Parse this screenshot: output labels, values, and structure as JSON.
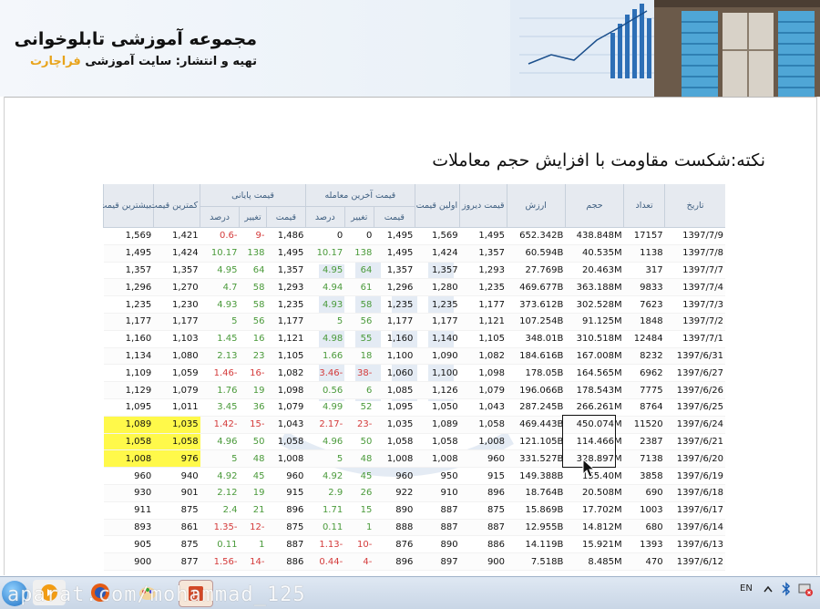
{
  "banner": {
    "title": "مجموعه آموزشی تابلوخوانی",
    "subtitle_prefix": "تهیه و انتشار: سایت آموزشی ",
    "subtitle_brand": "فراچارت"
  },
  "note": "نکته:شکست مقاومت  با افزایش حجم معاملات",
  "table": {
    "headers": {
      "date": "تاریخ",
      "count": "تعداد",
      "volume": "حجم",
      "value": "ارزش",
      "yesterday": "قیمت دیروز",
      "first": "اولین قیمت",
      "last_group": "قیمت آخرین معامله",
      "close_group": "قیمت پایانی",
      "min": "کمترین قیمت",
      "max": "بیشترین قیمت",
      "price": "قیمت",
      "change": "تغییر",
      "percent": "درصد"
    },
    "rows": [
      {
        "date": "1397/7/9",
        "count": "17157",
        "volume": "438.848M",
        "value": "652.342B",
        "yesterday": "1,495",
        "first": "1,569",
        "last": "1,495",
        "last_ch": "0",
        "last_pct": "0",
        "close": "1,486",
        "close_ch": "-9",
        "close_pct": "-0.6",
        "min": "1,421",
        "max": "1,569"
      },
      {
        "date": "1397/7/8",
        "count": "1138",
        "volume": "40.535M",
        "value": "60.594B",
        "yesterday": "1,357",
        "first": "1,424",
        "last": "1,495",
        "last_ch": "138",
        "last_pct": "10.17",
        "close": "1,495",
        "close_ch": "138",
        "close_pct": "10.17",
        "min": "1,424",
        "max": "1,495"
      },
      {
        "date": "1397/7/7",
        "count": "317",
        "volume": "20.463M",
        "value": "27.769B",
        "yesterday": "1,293",
        "first": "1,357",
        "last": "1,357",
        "last_ch": "64",
        "last_pct": "4.95",
        "close": "1,357",
        "close_ch": "64",
        "close_pct": "4.95",
        "min": "1,357",
        "max": "1,357"
      },
      {
        "date": "1397/7/4",
        "count": "9833",
        "volume": "363.188M",
        "value": "469.677B",
        "yesterday": "1,235",
        "first": "1,280",
        "last": "1,296",
        "last_ch": "61",
        "last_pct": "4.94",
        "close": "1,293",
        "close_ch": "58",
        "close_pct": "4.7",
        "min": "1,270",
        "max": "1,296"
      },
      {
        "date": "1397/7/3",
        "count": "7623",
        "volume": "302.528M",
        "value": "373.612B",
        "yesterday": "1,177",
        "first": "1,235",
        "last": "1,235",
        "last_ch": "58",
        "last_pct": "4.93",
        "close": "1,235",
        "close_ch": "58",
        "close_pct": "4.93",
        "min": "1,230",
        "max": "1,235"
      },
      {
        "date": "1397/7/2",
        "count": "1848",
        "volume": "91.125M",
        "value": "107.254B",
        "yesterday": "1,121",
        "first": "1,177",
        "last": "1,177",
        "last_ch": "56",
        "last_pct": "5",
        "close": "1,177",
        "close_ch": "56",
        "close_pct": "5",
        "min": "1,177",
        "max": "1,177"
      },
      {
        "date": "1397/7/1",
        "count": "12484",
        "volume": "310.518M",
        "value": "348.01B",
        "yesterday": "1,105",
        "first": "1,140",
        "last": "1,160",
        "last_ch": "55",
        "last_pct": "4.98",
        "close": "1,121",
        "close_ch": "16",
        "close_pct": "1.45",
        "min": "1,103",
        "max": "1,160"
      },
      {
        "date": "1397/6/31",
        "count": "8232",
        "volume": "167.008M",
        "value": "184.616B",
        "yesterday": "1,082",
        "first": "1,090",
        "last": "1,100",
        "last_ch": "18",
        "last_pct": "1.66",
        "close": "1,105",
        "close_ch": "23",
        "close_pct": "2.13",
        "min": "1,080",
        "max": "1,134"
      },
      {
        "date": "1397/6/27",
        "count": "6962",
        "volume": "164.565M",
        "value": "178.05B",
        "yesterday": "1,098",
        "first": "1,100",
        "last": "1,060",
        "last_ch": "-38",
        "last_pct": "-3.46",
        "close": "1,082",
        "close_ch": "-16",
        "close_pct": "-1.46",
        "min": "1,059",
        "max": "1,109"
      },
      {
        "date": "1397/6/26",
        "count": "7775",
        "volume": "178.543M",
        "value": "196.066B",
        "yesterday": "1,079",
        "first": "1,126",
        "last": "1,085",
        "last_ch": "6",
        "last_pct": "0.56",
        "close": "1,098",
        "close_ch": "19",
        "close_pct": "1.76",
        "min": "1,079",
        "max": "1,129"
      },
      {
        "date": "1397/6/25",
        "count": "8764",
        "volume": "266.261M",
        "value": "287.245B",
        "yesterday": "1,043",
        "first": "1,050",
        "last": "1,095",
        "last_ch": "52",
        "last_pct": "4.99",
        "close": "1,079",
        "close_ch": "36",
        "close_pct": "3.45",
        "min": "1,011",
        "max": "1,095"
      },
      {
        "date": "1397/6/24",
        "count": "11520",
        "volume": "450.074M",
        "value": "469.443B",
        "yesterday": "1,058",
        "first": "1,089",
        "last": "1,035",
        "last_ch": "-23",
        "last_pct": "-2.17",
        "close": "1,043",
        "close_ch": "-15",
        "close_pct": "-1.42",
        "min": "1,035",
        "max": "1,089",
        "highlight": true
      },
      {
        "date": "1397/6/21",
        "count": "2387",
        "volume": "114.466M",
        "value": "121.105B",
        "yesterday": "1,008",
        "first": "1,058",
        "last": "1,058",
        "last_ch": "50",
        "last_pct": "4.96",
        "close": "1,058",
        "close_ch": "50",
        "close_pct": "4.96",
        "min": "1,058",
        "max": "1,058",
        "highlight": true
      },
      {
        "date": "1397/6/20",
        "count": "7138",
        "volume": "328.897M",
        "value": "331.527B",
        "yesterday": "960",
        "first": "1,008",
        "last": "1,008",
        "last_ch": "48",
        "last_pct": "5",
        "close": "1,008",
        "close_ch": "48",
        "close_pct": "5",
        "min": "976",
        "max": "1,008",
        "highlight": true
      },
      {
        "date": "1397/6/19",
        "count": "3858",
        "volume": "155.40M",
        "value": "149.388B",
        "yesterday": "915",
        "first": "950",
        "last": "960",
        "last_ch": "45",
        "last_pct": "4.92",
        "close": "960",
        "close_ch": "45",
        "close_pct": "4.92",
        "min": "940",
        "max": "960"
      },
      {
        "date": "1397/6/18",
        "count": "690",
        "volume": "20.508M",
        "value": "18.764B",
        "yesterday": "896",
        "first": "910",
        "last": "922",
        "last_ch": "26",
        "last_pct": "2.9",
        "close": "915",
        "close_ch": "19",
        "close_pct": "2.12",
        "min": "901",
        "max": "930"
      },
      {
        "date": "1397/6/17",
        "count": "1003",
        "volume": "17.702M",
        "value": "15.869B",
        "yesterday": "875",
        "first": "887",
        "last": "890",
        "last_ch": "15",
        "last_pct": "1.71",
        "close": "896",
        "close_ch": "21",
        "close_pct": "2.4",
        "min": "875",
        "max": "911"
      },
      {
        "date": "1397/6/14",
        "count": "680",
        "volume": "14.812M",
        "value": "12.955B",
        "yesterday": "887",
        "first": "887",
        "last": "888",
        "last_ch": "1",
        "last_pct": "0.11",
        "close": "875",
        "close_ch": "-12",
        "close_pct": "-1.35",
        "min": "861",
        "max": "893"
      },
      {
        "date": "1397/6/13",
        "count": "1393",
        "volume": "15.921M",
        "value": "14.119B",
        "yesterday": "886",
        "first": "890",
        "last": "876",
        "last_ch": "-10",
        "last_pct": "-1.13",
        "close": "887",
        "close_ch": "1",
        "close_pct": "0.11",
        "min": "875",
        "max": "905"
      },
      {
        "date": "1397/6/12",
        "count": "470",
        "volume": "8.485M",
        "value": "7.518B",
        "yesterday": "900",
        "first": "897",
        "last": "896",
        "last_ch": "-4",
        "last_pct": "-0.44",
        "close": "886",
        "close_ch": "-14",
        "close_pct": "-1.56",
        "min": "877",
        "max": "900"
      }
    ]
  },
  "overlay_text": "aparat.com/mohammad_125",
  "tray": {
    "lang": "EN",
    "time": "",
    "date": ""
  },
  "colors": {
    "positive": "#4a9a3a",
    "negative": "#d43a3a",
    "highlight": "#fff94a",
    "header_text": "#3f5f80",
    "brand": "#e8a31a"
  }
}
